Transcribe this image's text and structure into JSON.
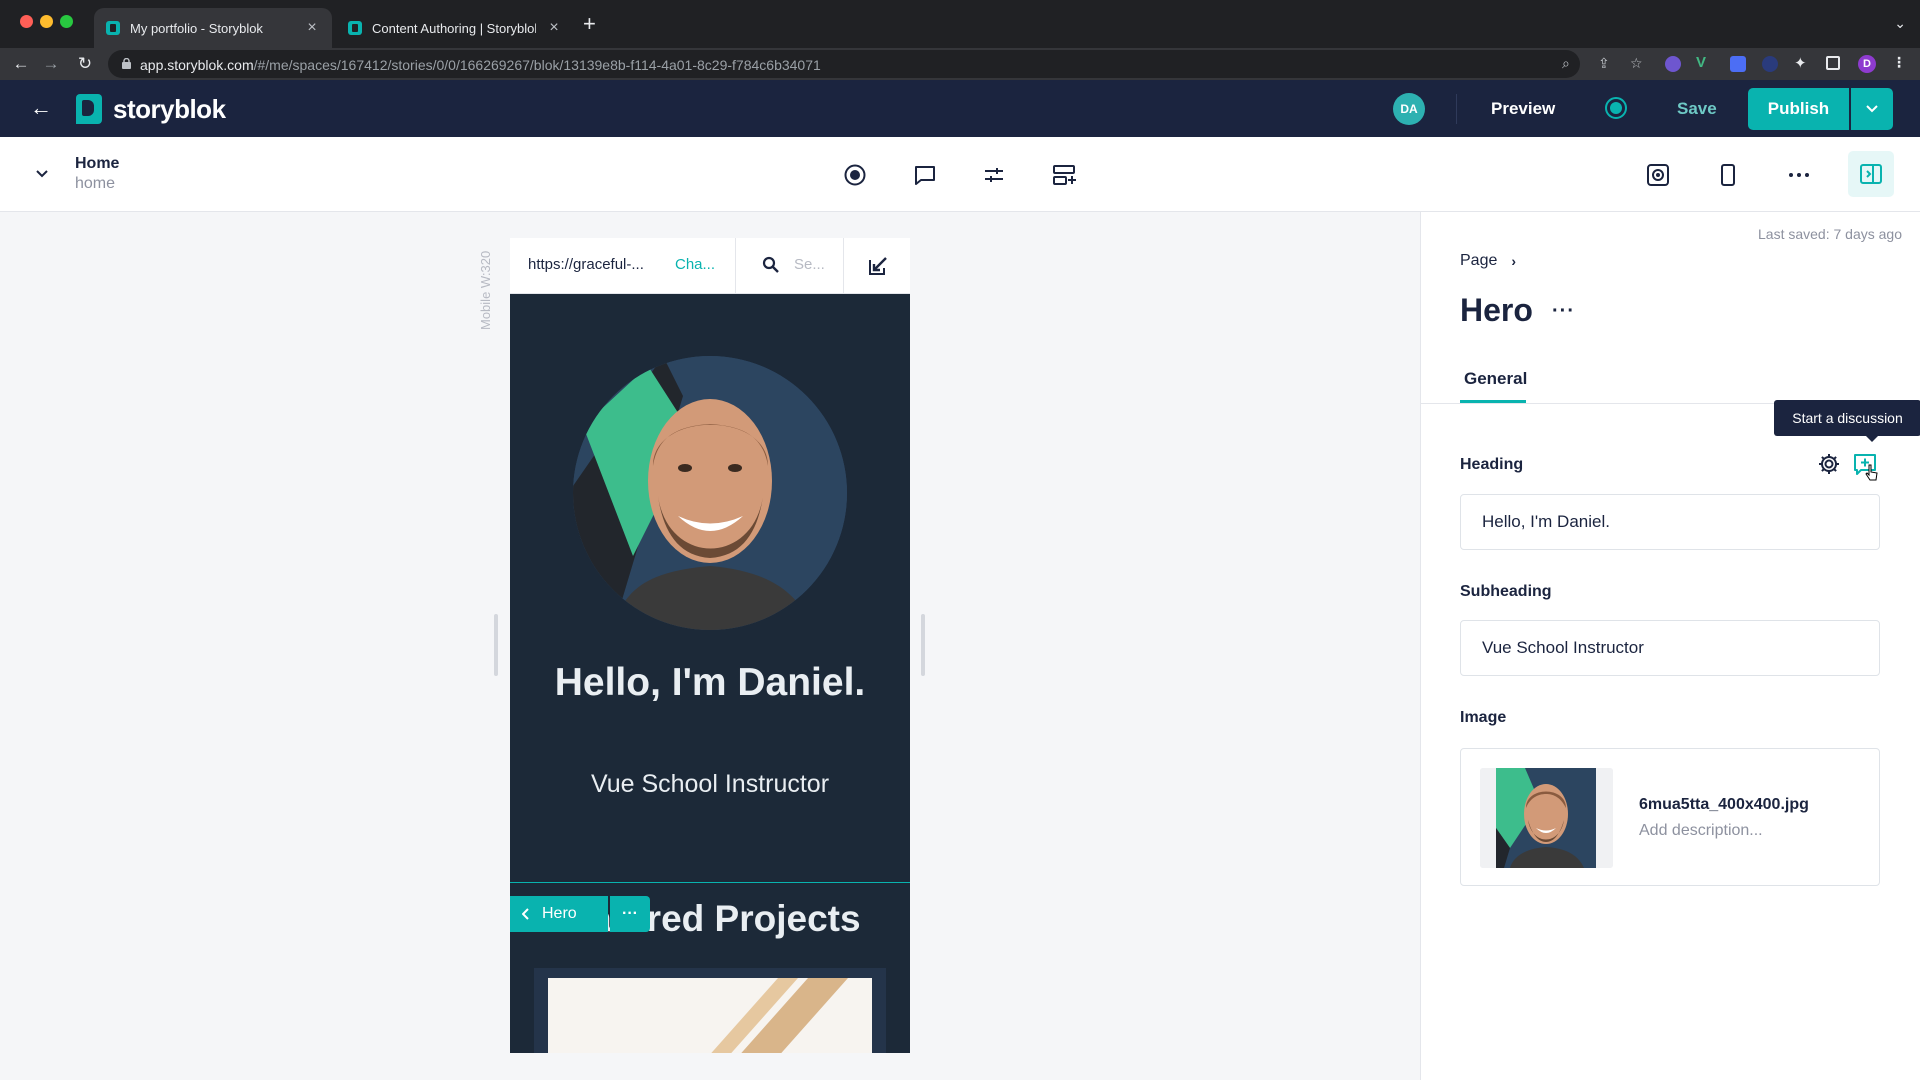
{
  "browser": {
    "tabs": [
      {
        "title": "My portfolio - Storyblok",
        "active": true
      },
      {
        "title": "Content Authoring | Storyblok",
        "active": false
      }
    ],
    "url_host": "app.storyblok.com",
    "url_path": "/#/me/spaces/167412/stories/0/0/166269267/blok/13139e8b-f114-4a01-8c29-f784c6b34071",
    "profile_initial": "D"
  },
  "header": {
    "brand": "storyblok",
    "avatar_initials": "DA",
    "preview_label": "Preview",
    "save_label": "Save",
    "publish_label": "Publish"
  },
  "toolbar": {
    "story_title": "Home",
    "story_slug": "home"
  },
  "preview": {
    "device_label": "Mobile W:320",
    "url": "https://graceful-...",
    "change_label": "Cha...",
    "search_placeholder": "Se...",
    "hero_heading": "Hello, I'm Daniel.",
    "hero_subheading": "Vue School Instructor",
    "hero_chip_label": "Hero",
    "next_section_heading": "Featured Projects"
  },
  "panel": {
    "last_saved": "Last saved: 7 days ago",
    "breadcrumb": "Page",
    "block_title": "Hero",
    "tab_general": "General",
    "tooltip": "Start a discussion",
    "fields": {
      "heading_label": "Heading",
      "heading_value": "Hello, I'm Daniel.",
      "subheading_label": "Subheading",
      "subheading_value": "Vue School Instructor",
      "image_label": "Image",
      "image_filename": "6mua5tta_400x400.jpg",
      "image_description_placeholder": "Add description..."
    }
  },
  "colors": {
    "brand_teal": "#09b3af",
    "header_navy": "#1b243f",
    "preview_bg": "#1c2938"
  }
}
